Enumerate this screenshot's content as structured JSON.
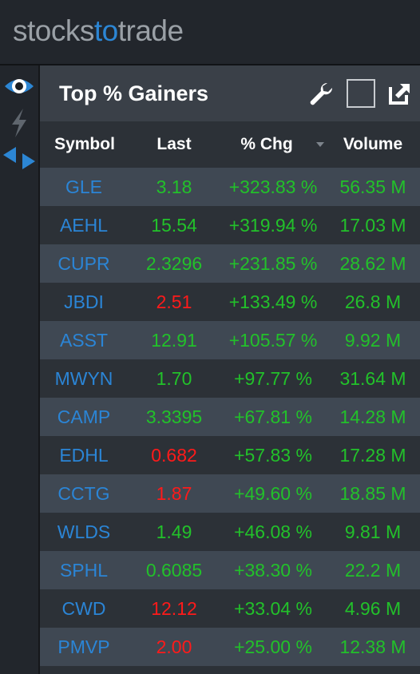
{
  "app": {
    "logo_part1": "stocks",
    "logo_part2": "to",
    "logo_part3": "trade",
    "accent_color": "#2c86d4"
  },
  "left_rail": {
    "icons": [
      "eye-icon",
      "lightning-icon",
      "arrows-icon"
    ]
  },
  "panel": {
    "title": "Top % Gainers",
    "toolbar_icons": [
      "wrench-icon",
      "maximize-square-icon",
      "popout-icon"
    ]
  },
  "columns": {
    "symbol": "Symbol",
    "last": "Last",
    "chg": "% Chg",
    "volume": "Volume",
    "sort_column": "chg",
    "sort_direction": "descending"
  },
  "rows": [
    {
      "symbol": "GLE",
      "last": "3.18",
      "last_dir": "up",
      "chg": "+323.83 %",
      "volume": "56.35 M"
    },
    {
      "symbol": "AEHL",
      "last": "15.54",
      "last_dir": "up",
      "chg": "+319.94 %",
      "volume": "17.03 M"
    },
    {
      "symbol": "CUPR",
      "last": "2.3296",
      "last_dir": "up",
      "chg": "+231.85 %",
      "volume": "28.62 M"
    },
    {
      "symbol": "JBDI",
      "last": "2.51",
      "last_dir": "down",
      "chg": "+133.49 %",
      "volume": "26.8 M"
    },
    {
      "symbol": "ASST",
      "last": "12.91",
      "last_dir": "up",
      "chg": "+105.57 %",
      "volume": "9.92 M"
    },
    {
      "symbol": "MWYN",
      "last": "1.70",
      "last_dir": "up",
      "chg": "+97.77 %",
      "volume": "31.64 M"
    },
    {
      "symbol": "CAMP",
      "last": "3.3395",
      "last_dir": "up",
      "chg": "+67.81 %",
      "volume": "14.28 M"
    },
    {
      "symbol": "EDHL",
      "last": "0.682",
      "last_dir": "down",
      "chg": "+57.83 %",
      "volume": "17.28 M"
    },
    {
      "symbol": "CCTG",
      "last": "1.87",
      "last_dir": "down",
      "chg": "+49.60 %",
      "volume": "18.85 M"
    },
    {
      "symbol": "WLDS",
      "last": "1.49",
      "last_dir": "up",
      "chg": "+46.08 %",
      "volume": "9.81 M"
    },
    {
      "symbol": "SPHL",
      "last": "0.6085",
      "last_dir": "up",
      "chg": "+38.30 %",
      "volume": "22.2 M"
    },
    {
      "symbol": "CWD",
      "last": "12.12",
      "last_dir": "down",
      "chg": "+33.04 %",
      "volume": "4.96 M"
    },
    {
      "symbol": "PMVP",
      "last": "2.00",
      "last_dir": "down",
      "chg": "+25.00 %",
      "volume": "12.38 M"
    }
  ],
  "colors": {
    "up": "#22c12a",
    "down": "#ff1a1a",
    "symbol": "#2b85d6",
    "row_alt": "#3f4853",
    "row_plain": "#2c3137"
  }
}
